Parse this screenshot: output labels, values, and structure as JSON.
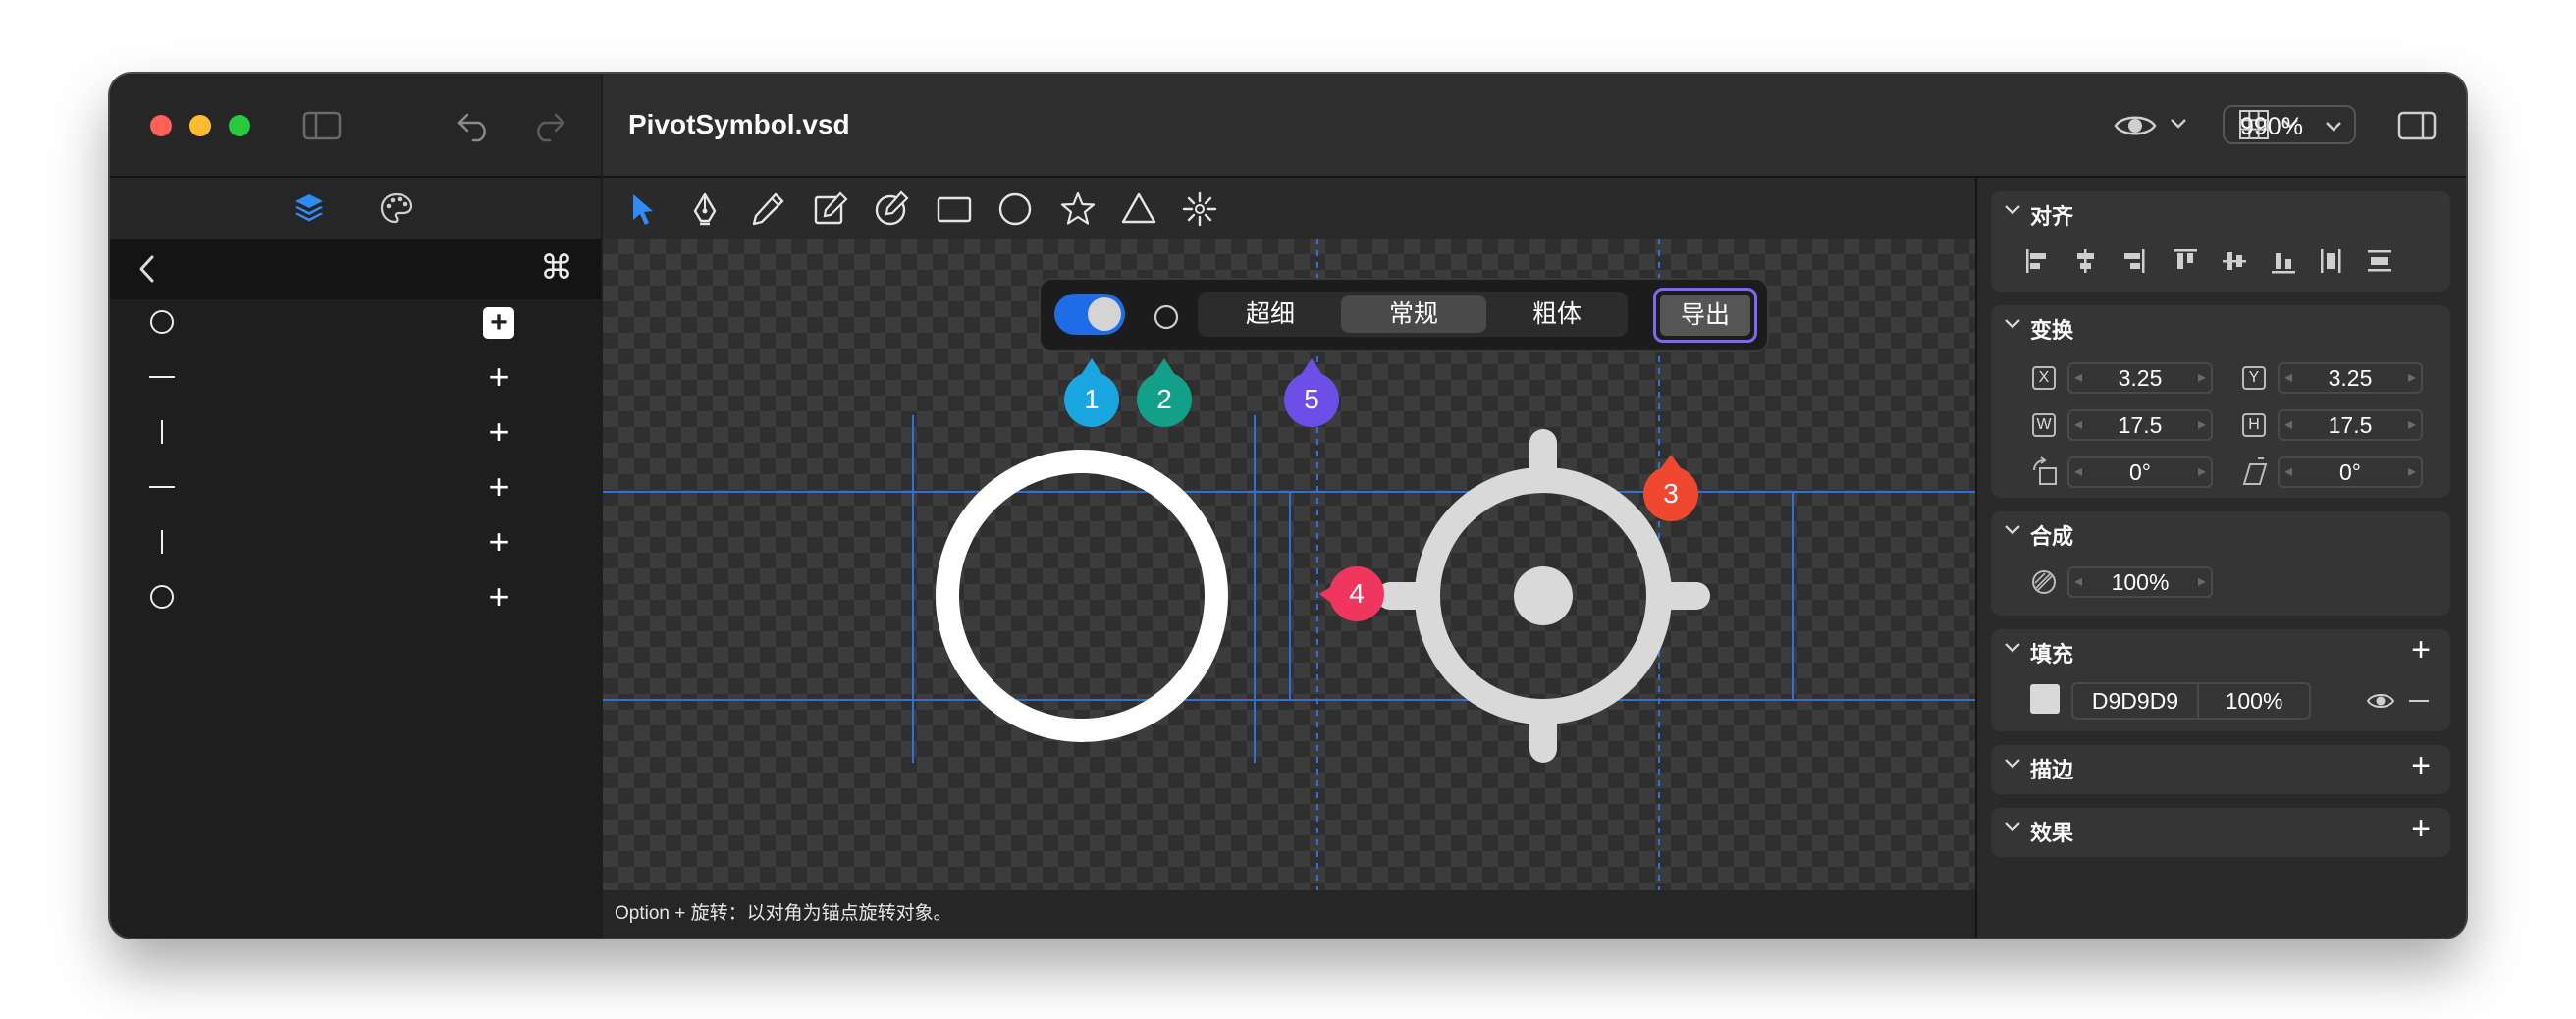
{
  "window": {
    "title": "PivotSymbol.vsd",
    "zoom": "990%",
    "status_text": "Option + 旋转：以对角为锚点旋转对象。"
  },
  "sidebar": {
    "command_symbol": "⌘",
    "layers": [
      {
        "shape": "circle-icon",
        "action": "add-boxed"
      },
      {
        "shape": "horizontal-line-icon",
        "action": "add"
      },
      {
        "shape": "vertical-line-icon",
        "action": "add"
      },
      {
        "shape": "horizontal-line-icon",
        "action": "add"
      },
      {
        "shape": "vertical-line-icon",
        "action": "add"
      },
      {
        "shape": "circle-icon",
        "action": "add"
      }
    ]
  },
  "floating_toolbar": {
    "toggle_on": true,
    "weights": [
      "超细",
      "常规",
      "粗体"
    ],
    "active_weight": "常规",
    "export_label": "导出"
  },
  "pins": [
    {
      "label": "1",
      "color": "#1aa6e0"
    },
    {
      "label": "2",
      "color": "#12a08a"
    },
    {
      "label": "3",
      "color": "#f0472f"
    },
    {
      "label": "4",
      "color": "#f0365e"
    },
    {
      "label": "5",
      "color": "#6b4fe6"
    }
  ],
  "inspector": {
    "align": {
      "title": "对齐"
    },
    "transform": {
      "title": "变换",
      "x": "3.25",
      "y": "3.25",
      "w": "17.5",
      "h": "17.5",
      "rotation": "0°",
      "skew": "0°",
      "labels": {
        "x": "X",
        "y": "Y",
        "w": "W",
        "h": "H"
      }
    },
    "compose": {
      "title": "合成",
      "opacity": "100%"
    },
    "fill": {
      "title": "填充",
      "hex": "D9D9D9",
      "opacity": "100%",
      "swatch": "#D9D9D9"
    },
    "stroke": {
      "title": "描边"
    },
    "effects": {
      "title": "效果"
    }
  }
}
